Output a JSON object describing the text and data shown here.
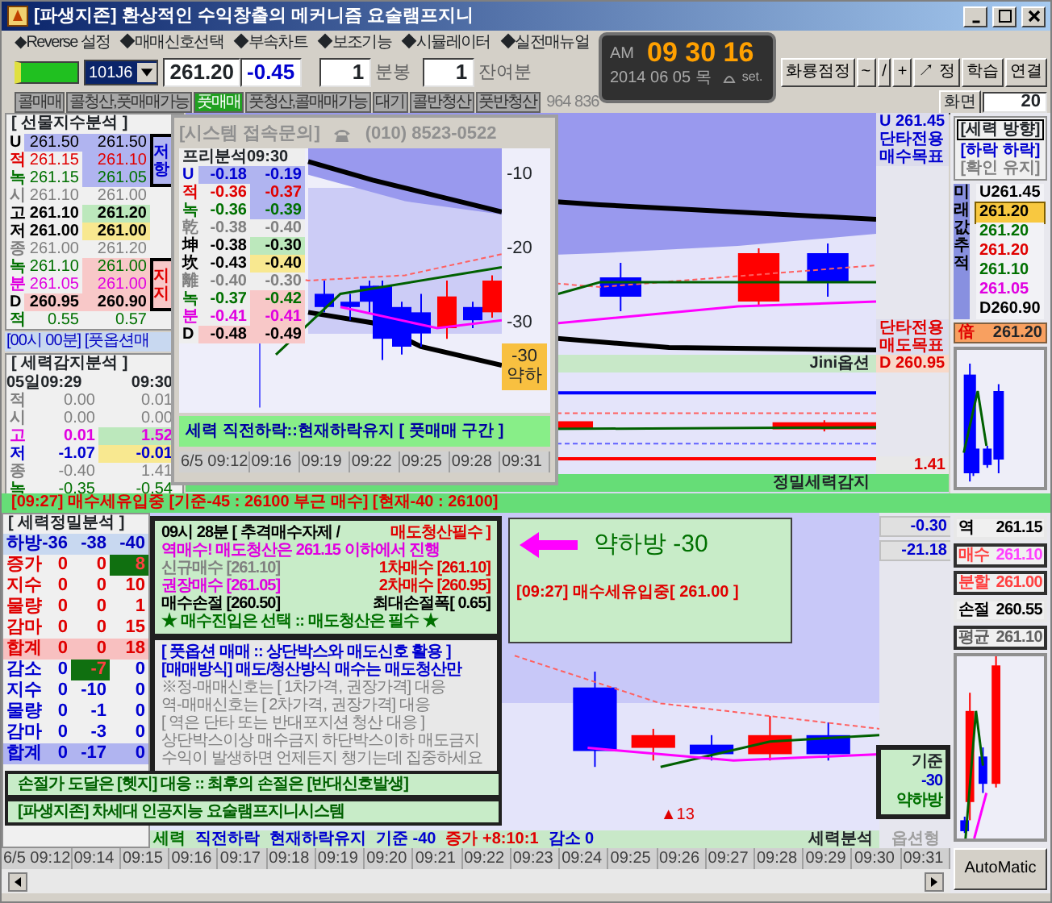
{
  "window": {
    "title": "[파생지존] 환상적인 수익창출의 메커니즘 요술램프지니"
  },
  "menu": [
    "◆Reverse 설정",
    "◆매매신호선택",
    "◆부속차트",
    "◆보조기능",
    "◆시뮬레이터",
    "◆실전매뉴얼"
  ],
  "toolbar": {
    "symbol": "101J6",
    "price": "261.20",
    "change": "-0.45",
    "interval": "1",
    "interval_unit": "분봉",
    "remaining": "1",
    "remaining_unit": "잔여분"
  },
  "signals": [
    {
      "label": "콜매매",
      "on": false
    },
    {
      "label": "콜청산,풋매매가능",
      "on": false
    },
    {
      "label": "풋매매",
      "on": true
    },
    {
      "label": "풋청산,콜매매가능",
      "on": false
    },
    {
      "label": "대기",
      "on": false
    },
    {
      "label": "콜반청산",
      "on": false
    },
    {
      "label": "풋반청산",
      "on": false
    }
  ],
  "volume": "964 836",
  "clock": {
    "ampm": "AM",
    "time": "09 30 16",
    "date": "2014 06 05 목",
    "set_label": "set."
  },
  "tool_buttons": [
    "화룡점정",
    "~",
    "/",
    "+",
    "↗ 정",
    "학습",
    "연결"
  ],
  "screen": {
    "label": "화면",
    "value": "20"
  },
  "futures_analysis": {
    "title": "[ 선물지수분석 ]",
    "rows": [
      {
        "label": "U",
        "values": [
          "261.50",
          "261.50"
        ],
        "color": "#000000",
        "kind": "u"
      },
      {
        "label": "적",
        "values": [
          "261.15",
          "261.10"
        ],
        "color": "#e00000",
        "kind": "u2"
      },
      {
        "label": "녹",
        "values": [
          "261.15",
          "261.05"
        ],
        "color": "#007000",
        "kind": "u2"
      },
      {
        "label": "시",
        "values": [
          "261.10",
          "261.00"
        ],
        "color": "#808080",
        "kind": "plain"
      },
      {
        "label": "고",
        "values": [
          "261.10",
          "261.20"
        ],
        "color": "#000000",
        "kind": "high"
      },
      {
        "label": "저",
        "values": [
          "261.00",
          "261.00"
        ],
        "color": "#000000",
        "kind": "low"
      },
      {
        "label": "종",
        "values": [
          "261.00",
          "261.20"
        ],
        "color": "#808080",
        "kind": "plain"
      },
      {
        "label": "녹",
        "values": [
          "261.10",
          "261.00"
        ],
        "color": "#007000",
        "kind": "d2"
      },
      {
        "label": "분",
        "values": [
          "261.05",
          "261.00"
        ],
        "color": "#e000e0",
        "kind": "d2"
      },
      {
        "label": "D",
        "values": [
          "260.95",
          "260.90"
        ],
        "color": "#000000",
        "kind": "d"
      },
      {
        "label": "적",
        "values": [
          "0.55",
          "0.57"
        ],
        "color": "#007000",
        "kind": "plain"
      }
    ],
    "tags": [
      {
        "label": "저항",
        "kind": "resist"
      },
      {
        "label": "지지",
        "kind": "support"
      }
    ]
  },
  "news_bar": "[00시 00분] [풋옵션매",
  "power_detect": {
    "title": "[ 세력감지분석 ]",
    "header": [
      "05일09:29",
      "09:30"
    ],
    "rows": [
      {
        "label": "적",
        "values": [
          "0.00",
          "0.01"
        ],
        "color": "#808080",
        "kind": "plain"
      },
      {
        "label": "시",
        "values": [
          "0.00",
          "0.00"
        ],
        "color": "#808080",
        "kind": "plain"
      },
      {
        "label": "고",
        "values": [
          "0.01",
          "1.52"
        ],
        "color": "#e000e0",
        "kind": "high"
      },
      {
        "label": "저",
        "values": [
          "-1.07",
          "-0.01"
        ],
        "color": "#0000d0",
        "kind": "low"
      },
      {
        "label": "종",
        "values": [
          "-0.40",
          "1.41"
        ],
        "color": "#808080",
        "kind": "plain"
      },
      {
        "label": "녹",
        "values": [
          "-0.35",
          "-0.54"
        ],
        "color": "#007000",
        "kind": "plain"
      }
    ]
  },
  "popup": {
    "title": "[시스템 접속문의]",
    "phone": "(010) 8523-0522",
    "table_title": "프리분석09:30",
    "rows": [
      {
        "label": "U",
        "values": [
          "-0.18",
          "-0.19"
        ],
        "color": "#0000d0",
        "kind": "u"
      },
      {
        "label": "적",
        "values": [
          "-0.36",
          "-0.37"
        ],
        "color": "#e00000",
        "kind": "u2"
      },
      {
        "label": "녹",
        "values": [
          "-0.36",
          "-0.39"
        ],
        "color": "#007000",
        "kind": "u2"
      },
      {
        "label": "乾",
        "values": [
          "-0.38",
          "-0.40"
        ],
        "color": "#808080",
        "kind": "plain"
      },
      {
        "label": "坤",
        "values": [
          "-0.38",
          "-0.30"
        ],
        "color": "#000000",
        "kind": "high"
      },
      {
        "label": "坎",
        "values": [
          "-0.43",
          "-0.40"
        ],
        "color": "#000000",
        "kind": "low"
      },
      {
        "label": "離",
        "values": [
          "-0.40",
          "-0.30"
        ],
        "color": "#808080",
        "kind": "plain"
      },
      {
        "label": "녹",
        "values": [
          "-0.37",
          "-0.42"
        ],
        "color": "#007000",
        "kind": "d2"
      },
      {
        "label": "분",
        "values": [
          "-0.41",
          "-0.41"
        ],
        "color": "#e000e0",
        "kind": "d2"
      },
      {
        "label": "D",
        "values": [
          "-0.48",
          "-0.49"
        ],
        "color": "#000000",
        "kind": "d"
      }
    ],
    "axis_labels": [
      "-10",
      "-20",
      "-30"
    ],
    "signal_box": {
      "value": "-30",
      "label": "약하"
    },
    "footer": "세력 직전하락::현재하락유지 [ 풋매매 구간 ]",
    "times": [
      "6/5 09:12",
      "09:16",
      "09:19",
      "09:22",
      "09:25",
      "09:28",
      "09:31"
    ]
  },
  "main_chart": {
    "labels": [
      {
        "text": "U 261.45",
        "color": "#0000d0"
      },
      {
        "text": "단타전용 매수목표",
        "color": "#0000d0"
      },
      {
        "text": "단타전용 매도목표",
        "color": "#e00000"
      }
    ],
    "option_label": "Jini옵션",
    "d_label": "D 260.95",
    "lower_reading": "1.41",
    "lower_title": "정밀세력감지"
  },
  "direction": {
    "title": "[세력 방향]",
    "lines": [
      {
        "text": "[하락 하락]",
        "color": "#0000d0"
      },
      {
        "text": "[확인 유지]",
        "color": "#808080"
      }
    ],
    "track_label": "미래값추적",
    "values": [
      {
        "text": "U261.45",
        "color": "#000000",
        "selected": false
      },
      {
        "text": "261.20",
        "color": "#000000",
        "selected": true
      },
      {
        "text": "261.20",
        "color": "#007000",
        "selected": false
      },
      {
        "text": "261.20",
        "color": "#e00000",
        "selected": false
      },
      {
        "text": "261.10",
        "color": "#007000",
        "selected": false
      },
      {
        "text": "261.05",
        "color": "#e000e0",
        "selected": false
      },
      {
        "text": "D260.90",
        "color": "#000000",
        "selected": false
      }
    ],
    "current": {
      "label": "倍",
      "value": "261.20"
    }
  },
  "alert_strip": "[09:27] 매수세유입중 [기준-45 : 26100 부근 매수] [현재-40 : 26100]",
  "precision": {
    "title": "[ 세력정밀분석 ]",
    "header": [
      "하방",
      "-36",
      "-38",
      "-40"
    ],
    "rows": [
      {
        "label": "증가",
        "kind": "inc",
        "cells": [
          {
            "text": "0",
            "on": false
          },
          {
            "text": "0",
            "on": false
          },
          {
            "text": "8",
            "on": true
          }
        ]
      },
      {
        "label": "지수",
        "kind": "inc",
        "cells": [
          {
            "text": "0",
            "on": false
          },
          {
            "text": "0",
            "on": false
          },
          {
            "text": "10",
            "on": false
          }
        ]
      },
      {
        "label": "물량",
        "kind": "inc",
        "cells": [
          {
            "text": "0",
            "on": false
          },
          {
            "text": "0",
            "on": false
          },
          {
            "text": "1",
            "on": false
          }
        ]
      },
      {
        "label": "감마",
        "kind": "inc",
        "cells": [
          {
            "text": "0",
            "on": false
          },
          {
            "text": "0",
            "on": false
          },
          {
            "text": "15",
            "on": false
          }
        ]
      },
      {
        "label": "합계",
        "kind": "inc_total",
        "cells": [
          {
            "text": "0",
            "on": false
          },
          {
            "text": "0",
            "on": false
          },
          {
            "text": "18",
            "on": false
          }
        ]
      },
      {
        "label": "감소",
        "kind": "dec",
        "cells": [
          {
            "text": "0",
            "on": false
          },
          {
            "text": "-7",
            "on": true
          },
          {
            "text": "0",
            "on": false
          }
        ]
      },
      {
        "label": "지수",
        "kind": "dec",
        "cells": [
          {
            "text": "0",
            "on": false
          },
          {
            "text": "-10",
            "on": false
          },
          {
            "text": "0",
            "on": false
          }
        ]
      },
      {
        "label": "물량",
        "kind": "dec",
        "cells": [
          {
            "text": "0",
            "on": false
          },
          {
            "text": "-1",
            "on": false
          },
          {
            "text": "0",
            "on": false
          }
        ]
      },
      {
        "label": "감마",
        "kind": "dec",
        "cells": [
          {
            "text": "0",
            "on": false
          },
          {
            "text": "-3",
            "on": false
          },
          {
            "text": "0",
            "on": false
          }
        ]
      },
      {
        "label": "합계",
        "kind": "dec_total",
        "cells": [
          {
            "text": "0",
            "on": false
          },
          {
            "text": "-17",
            "on": false
          },
          {
            "text": "0",
            "on": false
          }
        ]
      }
    ]
  },
  "info_box": {
    "lines": [
      [
        {
          "text": "09시 28분 [ 추격매수자제 /",
          "color": "#000000"
        },
        {
          "text": "매도청산필수 ]",
          "color": "#e00000"
        }
      ],
      [
        {
          "text": "역매수! 매도청산은 261.15 이하에서 진행",
          "color": "#e000e0"
        }
      ],
      [
        {
          "text": "신규매수 [261.10]",
          "color": "#808080"
        },
        {
          "text": "1차매수 [261.10]",
          "color": "#e00000"
        }
      ],
      [
        {
          "text": "권장매수 [261.05]",
          "color": "#e000e0"
        },
        {
          "text": "2차매수 [260.95]",
          "color": "#e00000"
        }
      ],
      [
        {
          "text": "매수손절 [260.50]",
          "color": "#000000"
        },
        {
          "text": "최대손절폭[ 0.65]",
          "color": "#000000"
        }
      ],
      [
        {
          "text": "★ 매수진입은 선택  ::  매도청산은 필수 ★",
          "color": "#007000"
        }
      ]
    ]
  },
  "notice_box": {
    "lines": [
      {
        "text": "[ 풋옵션 매매 :: 상단박스와 매도신호 활용 ]",
        "color": "#0000d0"
      },
      {
        "text": "[매매방식] 매도/청산방식 매수는 매도청산만",
        "color": "#0000d0"
      },
      {
        "text": "※정-매매신호는 [ 1차가격, 권장가격] 대응",
        "color": "#808080"
      },
      {
        "text": "역-매매신호는 [ 2차가격, 권장가격] 대응",
        "color": "#808080"
      },
      {
        "text": "[ 역은 단타 또는 반대포지션 청산 대응 ]",
        "color": "#808080"
      },
      {
        "text": "상단박스이상 매수금지 하단박스이하 매도금지",
        "color": "#808080"
      },
      {
        "text": "수익이 발생하면 언제든지 챙기는데 집중하세요",
        "color": "#808080"
      }
    ]
  },
  "footer_notes": [
    "손절가 도달은 [헷지] 대응 :: 최후의 손절은 [반대신호발생]",
    "[파생지존] 차세대 인공지능 요술램프지니시스템"
  ],
  "signal_callout": {
    "title": "약하방 -30",
    "message": "[09:27] 매수세유입중[ 261.00 ]"
  },
  "bottom_axis_labels": [
    "-0.30",
    "-21.18"
  ],
  "marker": "▲13",
  "base_box": {
    "label": "기준",
    "value": "-30",
    "state": "약하방"
  },
  "status_strip": [
    {
      "text": "세력",
      "color": "#007000"
    },
    {
      "text": "직전하락",
      "color": "#0000d0"
    },
    {
      "text": "현재하락유지",
      "color": "#0000d0"
    },
    {
      "text": "기준 -40",
      "color": "#0000d0"
    },
    {
      "text": "증가 +8:10:1",
      "color": "#e00000"
    },
    {
      "text": "감소 0",
      "color": "#0000d0"
    }
  ],
  "status_title": "세력분석",
  "status_option": "옵션형",
  "times": [
    "6/5 09:12",
    "09:14",
    "09:15",
    "09:16",
    "09:17",
    "09:18",
    "09:19",
    "09:20",
    "09:21",
    "09:22",
    "09:23",
    "09:24",
    "09:25",
    "09:26",
    "09:27",
    "09:28",
    "09:29",
    "09:30",
    "09:31"
  ],
  "orders": [
    {
      "label": "역",
      "value": "261.15",
      "kind": "plain"
    },
    {
      "label": "매수",
      "value": "261.10",
      "kind": "buy"
    },
    {
      "label": "분할",
      "value": "261.00",
      "kind": "split"
    },
    {
      "label": "손절",
      "value": "260.55",
      "kind": "plain"
    },
    {
      "label": "평균",
      "value": "261.10",
      "kind": "avg"
    }
  ],
  "auto_button": "AutoMatic"
}
